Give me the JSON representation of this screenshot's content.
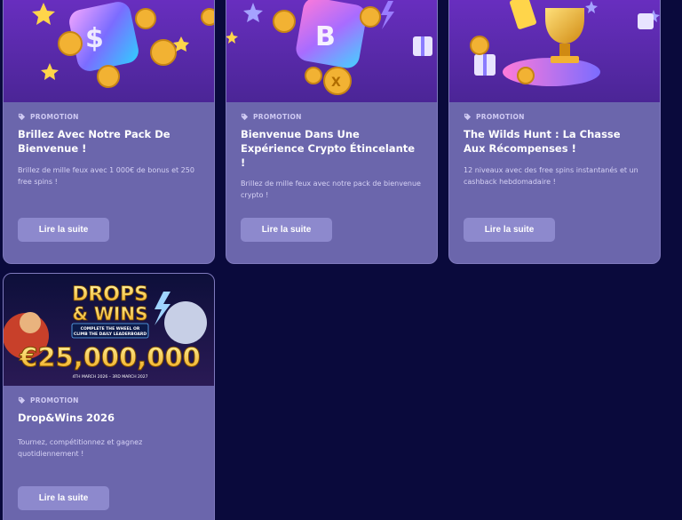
{
  "cards": [
    {
      "tag": "PROMOTION",
      "title": "Brillez Avec Notre Pack De Bienvenue !",
      "description": "Brillez de mille feux avec 1 000€ de bonus et 250 free spins !",
      "button": "Lire la suite",
      "banner_icon": "dice-coins-illustration"
    },
    {
      "tag": "PROMOTION",
      "title": "Bienvenue Dans Une Expérience Crypto Étincelante !",
      "description": "Brillez de mille feux avec notre pack de bienvenue crypto !",
      "button": "Lire la suite",
      "banner_icon": "crypto-cube-illustration"
    },
    {
      "tag": "PROMOTION",
      "title": "The Wilds Hunt : La Chasse Aux Récompenses !",
      "description": "12 niveaux avec des free spins instantanés et un cashback hebdomadaire !",
      "button": "Lire la suite",
      "banner_icon": "trophy-gift-illustration"
    },
    {
      "tag": "PROMOTION",
      "title": "Drop&Wins 2026",
      "description": "Tournez, compétitionnez et gagnez quotidiennement !",
      "button": "Lire la suite",
      "banner": {
        "headline_1": "DROPS",
        "headline_2": "& WINS",
        "subline_1": "COMPLETE THE WHEEL OR",
        "subline_2": "CLIMB THE DAILY LEADERBOARD",
        "amount": "€25,000,000",
        "dates": "4TH MARCH 2026 – 3RD MARCH 2027"
      }
    }
  ],
  "colors": {
    "page_bg": "#0a0a3c",
    "card_bg": "#6b66ac",
    "button_bg": "#8d89cd",
    "banner_purple": "#5a2fa0"
  }
}
